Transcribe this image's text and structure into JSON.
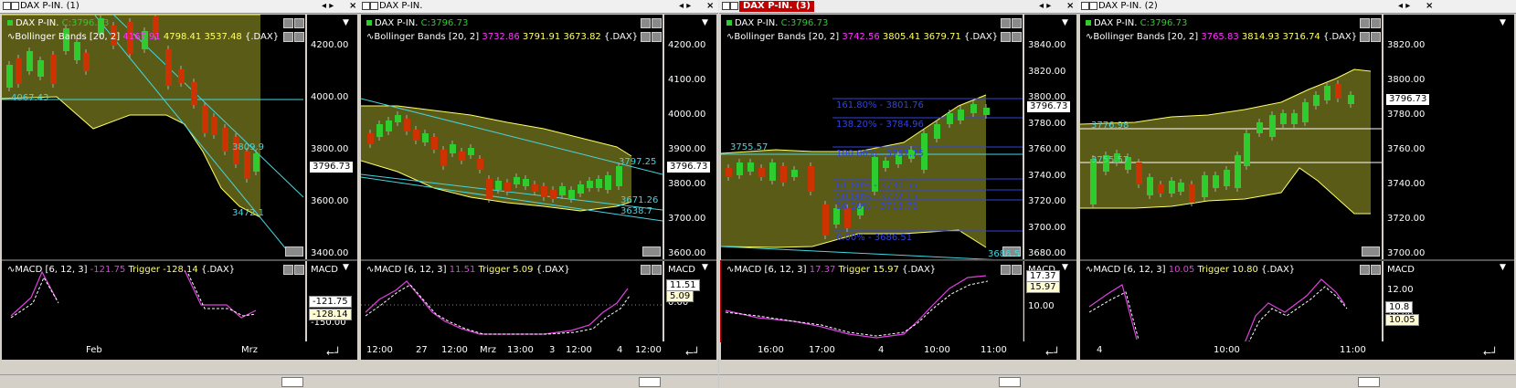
{
  "panels": [
    {
      "title": "DAX P-IN. (1)",
      "symbol": "DAX P-IN.",
      "close_label": "C:3796.73",
      "boll_label": "Bollinger Bands [20, 2]",
      "boll_mid": "4167.91",
      "boll_upper": "4798.41",
      "boll_lower": "3537.48",
      "boll_suffix": "{.DAX}",
      "yticks": [
        "4200.00",
        "4000.00",
        "3800.00",
        "3600.00",
        "3400.00"
      ],
      "price_tag": "3796.73",
      "annotations": [
        "4067.43",
        "3809.9",
        "3472.1"
      ],
      "macd_label": "MACD [6, 12, 3]",
      "macd_value": "-121.75",
      "trigger_label": "Trigger",
      "trigger_value": "-128.14",
      "macd_suffix": "{.DAX}",
      "macd_axis": "MACD",
      "macd_ticks": [
        "-150.00"
      ],
      "macd_tag": "-121.75",
      "macd_tag2": "-128.14",
      "xticks": [
        "Feb",
        "Mrz"
      ]
    },
    {
      "title": "DAX P-IN.",
      "symbol": "DAX P-IN.",
      "close_label": "C:3796.73",
      "boll_label": "Bollinger Bands [20, 2]",
      "boll_mid": "3732.86",
      "boll_upper": "3791.91",
      "boll_lower": "3673.82",
      "boll_suffix": "{.DAX}",
      "yticks": [
        "4200.00",
        "4100.00",
        "4000.00",
        "3900.00",
        "3800.00",
        "3700.00",
        "3600.00"
      ],
      "price_tag": "3796.73",
      "annotations": [
        "3797.25",
        "3671.26",
        "3638.7"
      ],
      "macd_label": "MACD [6, 12, 3]",
      "macd_value": "11.51",
      "trigger_label": "Trigger",
      "trigger_value": "5.09",
      "macd_suffix": "{.DAX}",
      "macd_axis": "MACD",
      "macd_ticks": [
        "0.00"
      ],
      "macd_tag": "11.51",
      "macd_tag2": "5.09",
      "xticks": [
        "12:00",
        "27",
        "12:00",
        "Mrz",
        "13:00",
        "3",
        "12:00",
        "4",
        "12:00"
      ]
    },
    {
      "title": "DAX P-IN. (3)",
      "symbol": "DAX P-IN.",
      "close_label": "C:3796.73",
      "boll_label": "Bollinger Bands [20, 2]",
      "boll_mid": "3742.56",
      "boll_upper": "3805.41",
      "boll_lower": "3679.71",
      "boll_suffix": "{.DAX}",
      "yticks": [
        "3840.00",
        "3820.00",
        "3800.00",
        "3780.00",
        "3760.00",
        "3740.00",
        "3720.00",
        "3700.00",
        "3680.00"
      ],
      "price_tag": "3796.73",
      "annotations": [
        "3755.57",
        "161.80% - 3801.76",
        "138.20% - 3784.96",
        "100.00% - 3757.75",
        "61.80% - 3730.55",
        "50.00% - 3722.15",
        "38.20% - 3713.72",
        "0.00% - 3686.51",
        "3686.5"
      ],
      "macd_label": "MACD [6, 12, 3]",
      "macd_value": "17.37",
      "trigger_label": "Trigger",
      "trigger_value": "15.97",
      "macd_suffix": "{.DAX}",
      "macd_axis": "MACD",
      "macd_ticks": [
        "10.00"
      ],
      "macd_tag": "17.37",
      "macd_tag2": "15.97",
      "xticks": [
        "16:00",
        "17:00",
        "4",
        "10:00",
        "11:00"
      ]
    },
    {
      "title": "DAX P-IN. (2)",
      "symbol": "DAX P-IN.",
      "close_label": "C:3796.73",
      "boll_label": "Bollinger Bands [20, 2]",
      "boll_mid": "3765.83",
      "boll_upper": "3814.93",
      "boll_lower": "3716.74",
      "boll_suffix": "{.DAX}",
      "yticks": [
        "3820.00",
        "3800.00",
        "3780.00",
        "3760.00",
        "3740.00",
        "3720.00",
        "3700.00"
      ],
      "price_tag": "3796.73",
      "annotations": [
        "3776.98",
        "3755.57"
      ],
      "macd_label": "MACD [6, 12, 3]",
      "macd_value": "10.05",
      "trigger_label": "Trigger",
      "trigger_value": "10.80",
      "macd_suffix": "{.DAX}",
      "macd_axis": "MACD",
      "macd_ticks": [
        "12.00",
        "10.00"
      ],
      "macd_tag": "10.8",
      "macd_tag2": "10.05",
      "xticks": [
        "4",
        "10:00",
        "11:00"
      ]
    }
  ],
  "colors": {
    "band_fill": "#6b6b1c",
    "band_line": "#ffff66",
    "bull": "#2ecc2e",
    "bear": "#cc3300",
    "macd": "#e040e0",
    "trigger": "#ffffff",
    "boll_mid_color": "#ff33ff",
    "boll_upper_color": "#ffff66",
    "annot": "#44d6e0",
    "fib": "#3344dd"
  }
}
